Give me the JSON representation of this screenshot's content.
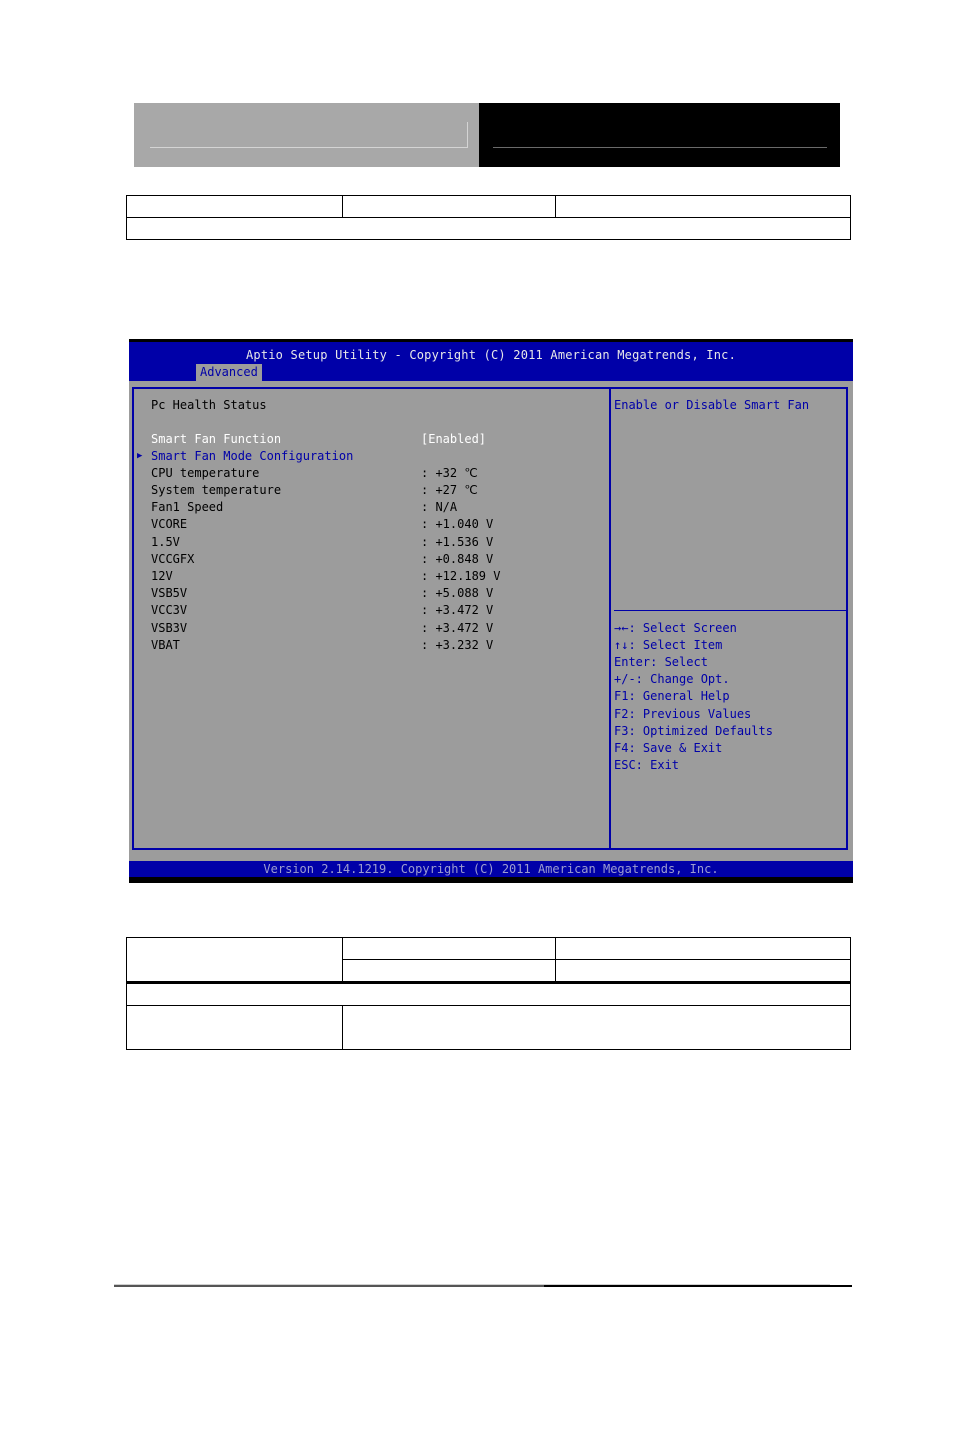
{
  "bios": {
    "title": "Aptio Setup Utility - Copyright (C) 2011 American Megatrends, Inc.",
    "active_tab": "Advanced",
    "section_title": "Pc Health Status",
    "settings": [
      {
        "label": "Smart Fan Function",
        "value": "[Enabled]"
      }
    ],
    "submenu": {
      "label": "Smart Fan Mode Configuration",
      "icon": "triangle-right"
    },
    "readings": [
      {
        "label": "CPU temperature",
        "value": ": +32 ℃"
      },
      {
        "label": "System temperature",
        "value": ": +27 ℃"
      },
      {
        "label": "Fan1 Speed",
        "value": ": N/A"
      },
      {
        "label": "VCORE",
        "value": ": +1.040 V"
      },
      {
        "label": "1.5V",
        "value": ": +1.536 V"
      },
      {
        "label": "VCCGFX",
        "value": ": +0.848 V"
      },
      {
        "label": "12V",
        "value": ": +12.189 V"
      },
      {
        "label": "VSB5V",
        "value": ": +5.088 V"
      },
      {
        "label": "VCC3V",
        "value": ": +3.472 V"
      },
      {
        "label": "VSB3V",
        "value": ": +3.472 V"
      },
      {
        "label": "VBAT",
        "value": ": +3.232 V"
      }
    ],
    "help_text": "Enable or Disable Smart Fan",
    "key_help": [
      "→←: Select Screen",
      "↑↓: Select Item",
      "Enter: Select",
      "+/-: Change Opt.",
      "F1: General Help",
      "F2: Previous Values",
      "F3: Optimized Defaults",
      "F4: Save & Exit",
      "ESC: Exit"
    ],
    "footer": "Version 2.14.1219. Copyright (C) 2011 American Megatrends, Inc.",
    "colors": {
      "bar_blue": "#0000a8",
      "panel_gray": "#9c9c9c",
      "highlight_white": "#ffffff"
    }
  }
}
